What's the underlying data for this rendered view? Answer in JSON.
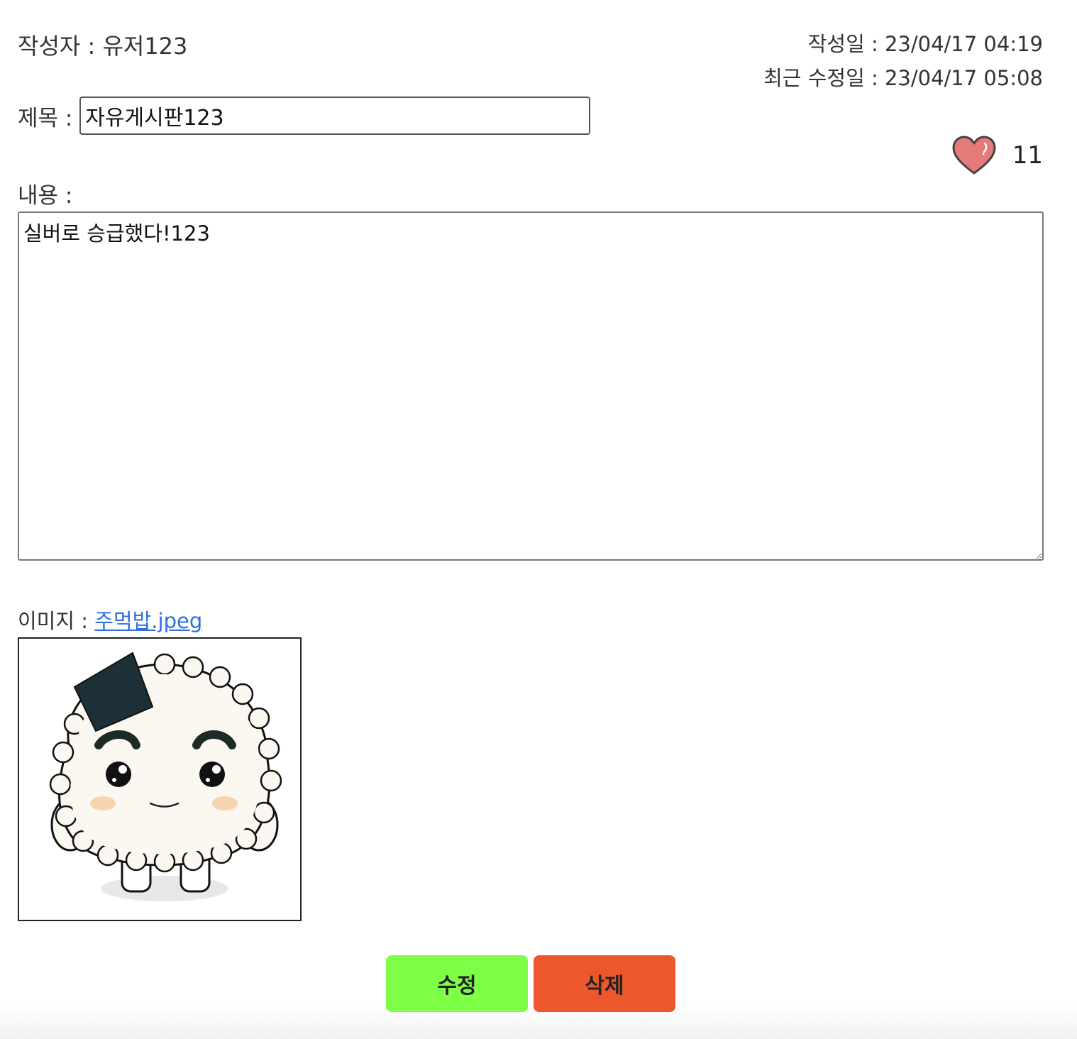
{
  "author": {
    "text": "작성자 : 유저123"
  },
  "dates": {
    "created": "작성일 : 23/04/17 04:19",
    "modified": "최근 수정일 : 23/04/17 05:08"
  },
  "title": {
    "label": "제목 :",
    "value": "자유게시판123"
  },
  "like": {
    "icon": "heart-icon",
    "count": "11",
    "color": "#e57a7a"
  },
  "content": {
    "label": "내용 :",
    "value": "실버로 승급했다!123"
  },
  "image": {
    "label": "이미지 : ",
    "filename": "주먹밥.jpeg",
    "preview": "rice-ball-character"
  },
  "actions": {
    "edit_label": "수정",
    "delete_label": "삭제",
    "edit_color": "#7dff47",
    "delete_color": "#ec572c"
  }
}
